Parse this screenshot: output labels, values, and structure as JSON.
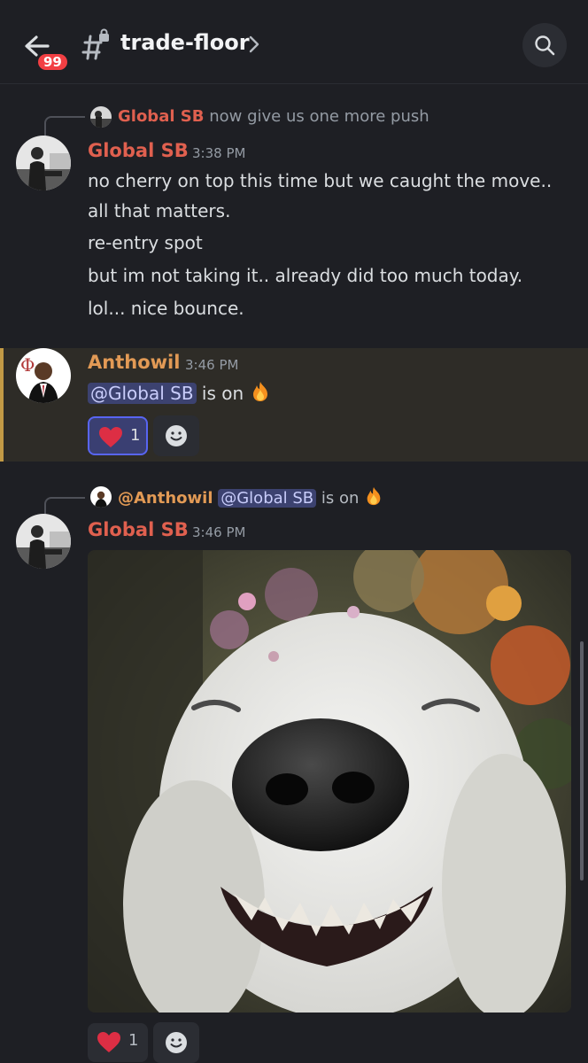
{
  "header": {
    "badge": "99",
    "channel": "trade-floor"
  },
  "messages": [
    {
      "reply_preview": {
        "author": "Global SB",
        "text": "now give us one more push"
      },
      "author": "Global SB",
      "time": "3:38 PM",
      "lines": [
        "no cherry on top this time but we caught the move..",
        "all that matters.",
        "re-entry spot",
        "but im not taking it.. already did too much today.",
        "lol... nice bounce."
      ]
    },
    {
      "author": "Anthowil",
      "time": "3:46 PM",
      "mention": "@Global SB",
      "text": " is on",
      "emoji": "fire",
      "reactions": [
        {
          "emoji": "heart",
          "count": "1",
          "active": true
        }
      ]
    },
    {
      "reply_preview": {
        "author": "@Anthowil",
        "mention": "@Global SB",
        "text": " is on",
        "emoji": "fire"
      },
      "author": "Global SB",
      "time": "3:46 PM",
      "attachment": "smiling-dog-flower-crown-image",
      "reactions": [
        {
          "emoji": "heart",
          "count": "1",
          "active": false
        }
      ]
    }
  ],
  "colors": {
    "background": "#1e1f24",
    "globalsb": "#e0604f",
    "anthowil": "#e29a55",
    "mention_bg": "#3c4270",
    "highlight_bar": "#c29a45"
  }
}
